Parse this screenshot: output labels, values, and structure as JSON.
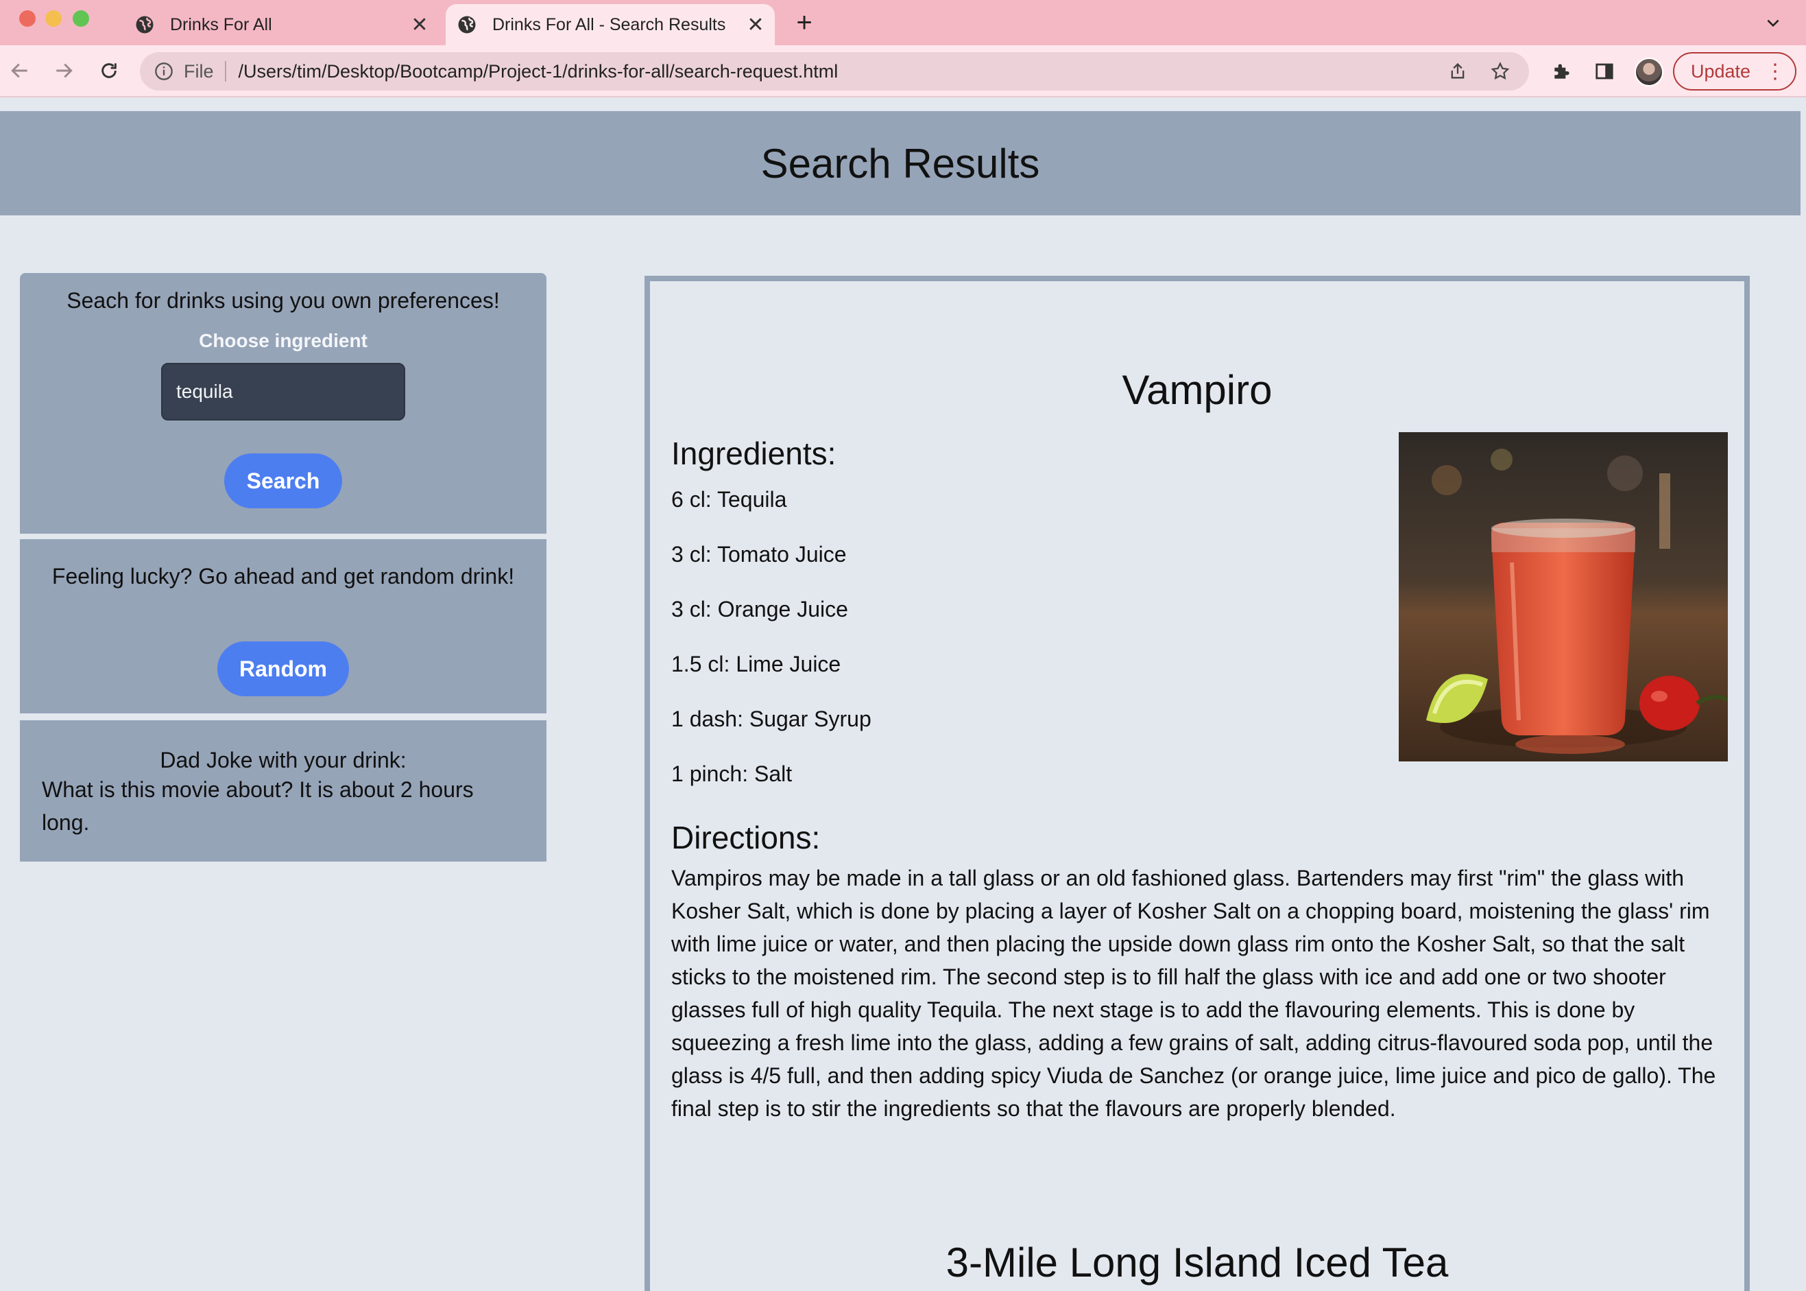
{
  "browser": {
    "tabs": [
      {
        "title": "Drinks For All",
        "active": false
      },
      {
        "title": "Drinks For All - Search Results",
        "active": true
      }
    ],
    "address": {
      "scheme": "File",
      "url": "/Users/tim/Desktop/Bootcamp/Project-1/drinks-for-all/search-request.html"
    },
    "update_label": "Update",
    "icons": [
      "globe-icon",
      "close-icon",
      "plus-icon",
      "chevron-down-icon",
      "back-arrow-icon",
      "forward-arrow-icon",
      "reload-icon",
      "info-icon",
      "share-icon",
      "star-icon",
      "puzzle-icon",
      "sidepanel-icon",
      "kebab-menu-icon"
    ],
    "colors": {
      "tabstrip": "#f4b8c4",
      "toolbar": "#fde7ec",
      "update": "#b23a3a"
    }
  },
  "page": {
    "title": "Search Results",
    "colors": {
      "header": "#96a4b8",
      "background": "#e3e8ef",
      "button": "#4d7ef0",
      "input": "#374151"
    }
  },
  "sidebar": {
    "search": {
      "prompt": "Seach for drinks using you own preferences!",
      "label": "Choose ingredient",
      "input_value": "tequila",
      "button_label": "Search"
    },
    "random": {
      "prompt": "Feeling lucky? Go ahead and get random drink!",
      "button_label": "Random"
    },
    "joke": {
      "title": "Dad Joke with your drink:",
      "text": "What is this movie about? It is about 2 hours long."
    }
  },
  "results": [
    {
      "name": "Vampiro",
      "ingredients_heading": "Ingredients:",
      "ingredients": [
        "6 cl: Tequila",
        "3 cl: Tomato Juice",
        "3 cl: Orange Juice",
        "1.5 cl: Lime Juice",
        "1 dash: Sugar Syrup",
        "1 pinch: Salt"
      ],
      "directions_heading": "Directions:",
      "directions": "Vampiros may be made in a tall glass or an old fashioned glass. Bartenders may first \"rim\" the glass with Kosher Salt, which is done by placing a layer of Kosher Salt on a chopping board, moistening the glass' rim with lime juice or water, and then placing the upside down glass rim onto the Kosher Salt, so that the salt sticks to the moistened rim. The second step is to fill half the glass with ice and add one or two shooter glasses full of high quality Tequila. The next stage is to add the flavouring elements. This is done by squeezing a fresh lime into the glass, adding a few grains of salt, adding citrus-flavoured soda pop, until the glass is 4/5 full, and then adding spicy Viuda de Sanchez (or orange juice, lime juice and pico de gallo). The final step is to stir the ingredients so that the flavours are properly blended."
    },
    {
      "name": "3-Mile Long Island Iced Tea"
    }
  ]
}
